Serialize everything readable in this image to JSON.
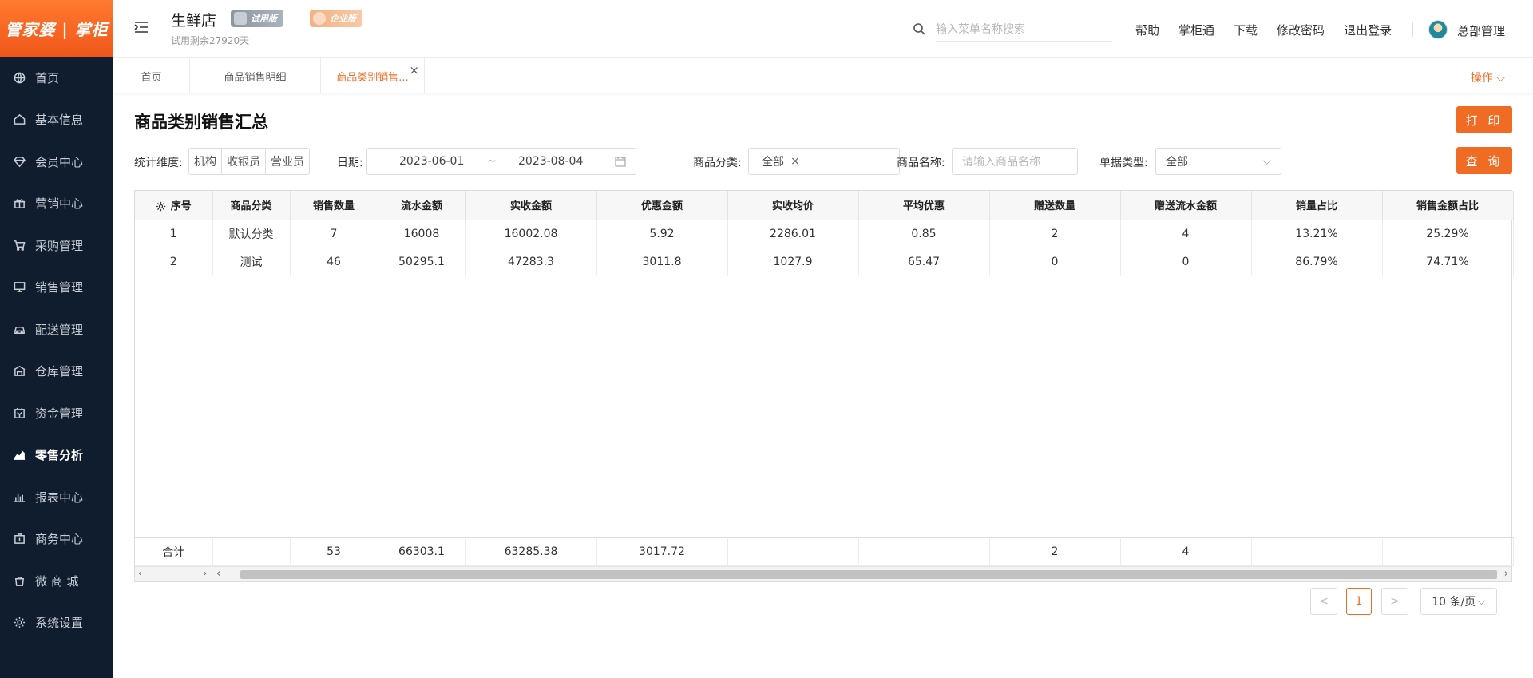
{
  "brand": {
    "logo_text": "管家婆 | 掌柜"
  },
  "sidebar": {
    "items": [
      {
        "label": "首页",
        "icon": "globe-icon"
      },
      {
        "label": "基本信息",
        "icon": "home-icon"
      },
      {
        "label": "会员中心",
        "icon": "diamond-icon"
      },
      {
        "label": "营销中心",
        "icon": "gift-icon"
      },
      {
        "label": "采购管理",
        "icon": "cart-icon"
      },
      {
        "label": "销售管理",
        "icon": "monitor-icon"
      },
      {
        "label": "配送管理",
        "icon": "car-icon"
      },
      {
        "label": "仓库管理",
        "icon": "warehouse-icon"
      },
      {
        "label": "资金管理",
        "icon": "wallet-icon"
      },
      {
        "label": "零售分析",
        "icon": "chart-icon"
      },
      {
        "label": "报表中心",
        "icon": "bar-chart-icon"
      },
      {
        "label": "商务中心",
        "icon": "briefcase-icon"
      },
      {
        "label": "微 商 城",
        "icon": "bag-icon"
      },
      {
        "label": "系统设置",
        "icon": "gear-icon"
      }
    ],
    "active_index": 9
  },
  "header": {
    "shop_name": "生鲜店",
    "trial_remaining": "试用剩余27920天",
    "badge_trial": "试用版",
    "badge_enterprise": "企业版",
    "search_placeholder": "输入菜单名称搜索",
    "links": [
      "帮助",
      "掌柜通",
      "下载",
      "修改密码",
      "退出登录"
    ],
    "user_name": "总部管理"
  },
  "tabs": {
    "items": [
      {
        "label": "首页"
      },
      {
        "label": "商品销售明细"
      },
      {
        "label": "商品类别销售..."
      }
    ],
    "active_index": 2,
    "operations": "操作"
  },
  "page": {
    "title": "商品类别销售汇总",
    "print_button": "打 印",
    "query_button": "查 询"
  },
  "filters": {
    "dimension_label": "统计维度:",
    "dimension_options": [
      "机构",
      "收银员",
      "营业员"
    ],
    "date_label": "日期:",
    "date_start": "2023-06-01",
    "date_sep": "~",
    "date_end": "2023-08-04",
    "category_label": "商品分类:",
    "category_value": "全部",
    "category_clear": "×",
    "product_label": "商品名称:",
    "product_placeholder": "请输入商品名称",
    "doc_type_label": "单据类型:",
    "doc_type_value": "全部"
  },
  "table": {
    "columns": [
      "序号",
      "商品分类",
      "销售数量",
      "流水金额",
      "实收金额",
      "优惠金额",
      "实收均价",
      "平均优惠",
      "赠送数量",
      "赠送流水金额",
      "销量占比",
      "销售金额占比"
    ],
    "rows": [
      [
        "1",
        "默认分类",
        "7",
        "16008",
        "16002.08",
        "5.92",
        "2286.01",
        "0.85",
        "2",
        "4",
        "13.21%",
        "25.29%"
      ],
      [
        "2",
        "测试",
        "46",
        "50295.1",
        "47283.3",
        "3011.8",
        "1027.9",
        "65.47",
        "0",
        "0",
        "86.79%",
        "74.71%"
      ]
    ],
    "totals": [
      "合计",
      "",
      "53",
      "66303.1",
      "63285.38",
      "3017.72",
      "",
      "",
      "2",
      "4",
      "",
      ""
    ]
  },
  "pagination": {
    "current_page": "1",
    "prev": "<",
    "next": ">",
    "page_size": "10 条/页"
  }
}
